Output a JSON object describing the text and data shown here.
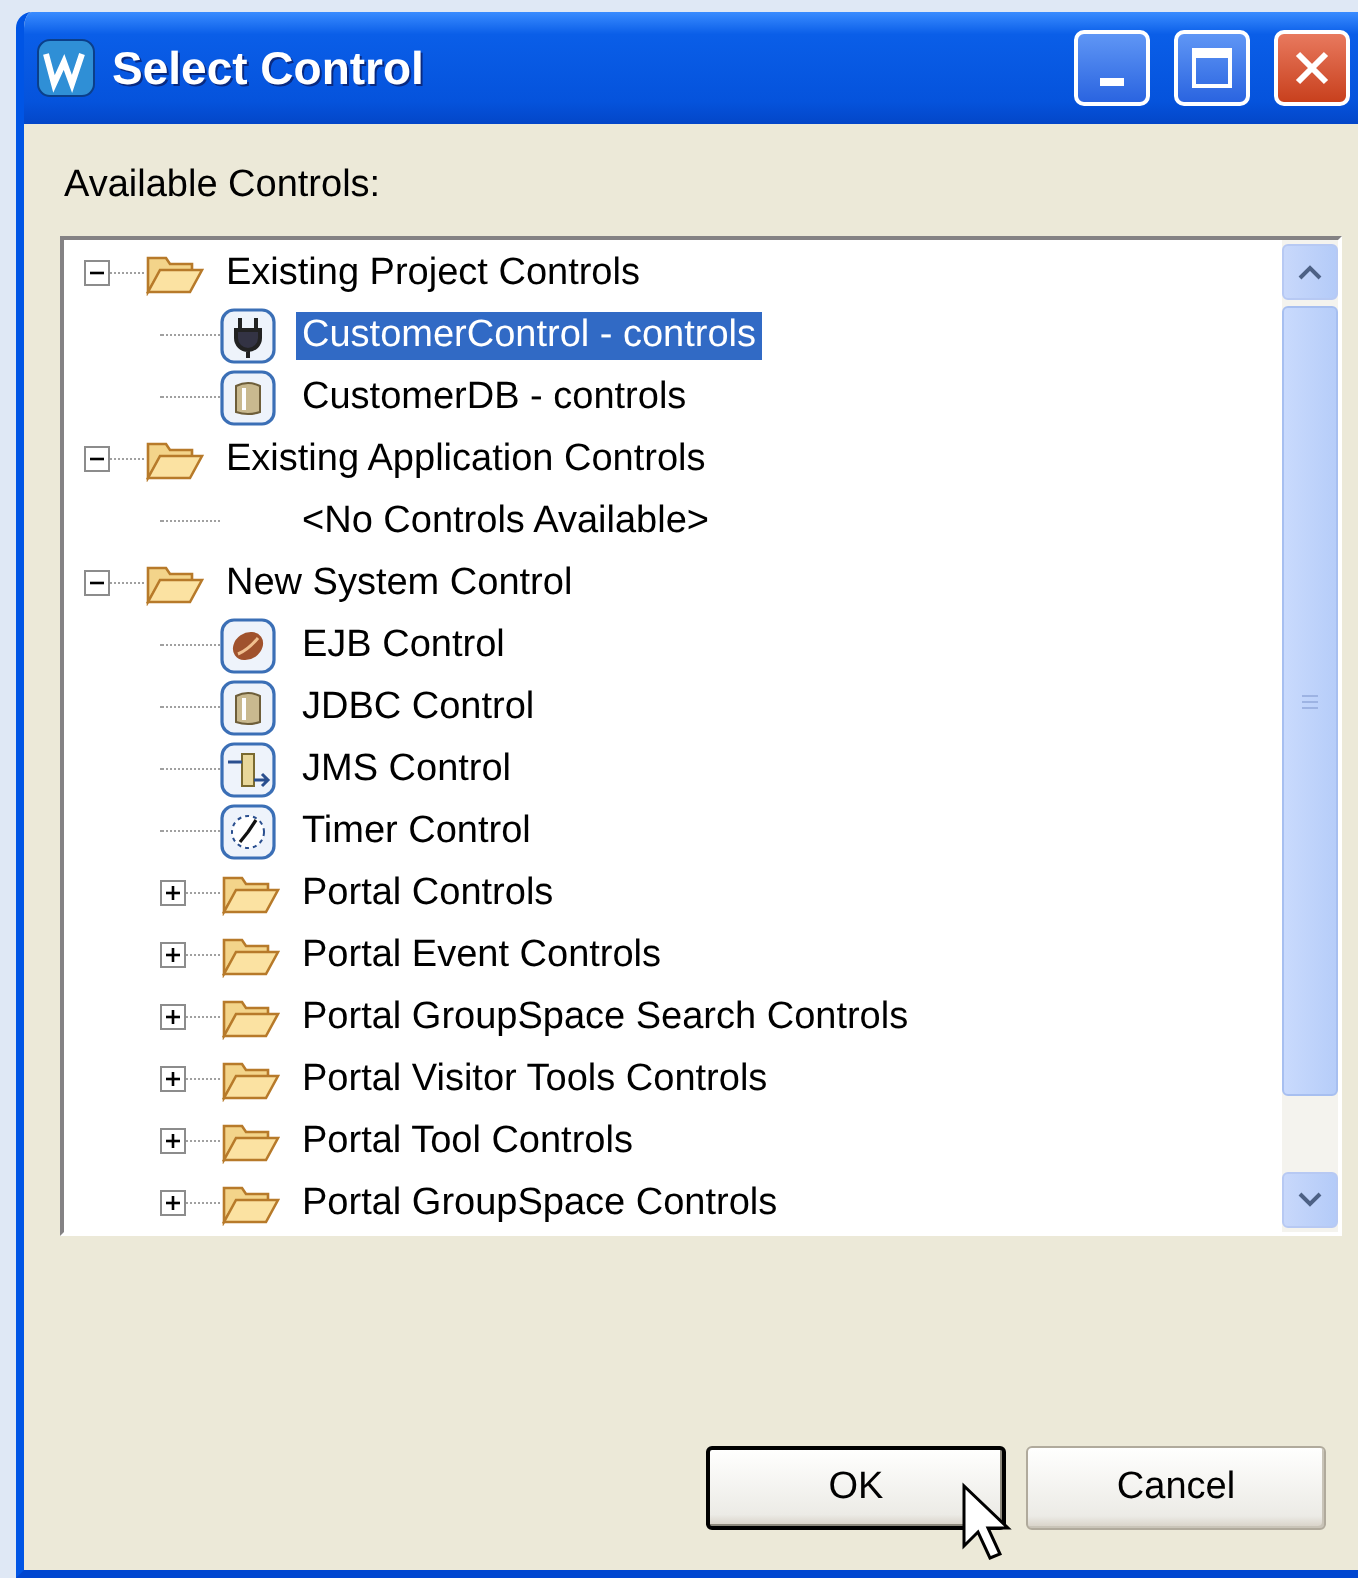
{
  "window": {
    "title": "Select Control"
  },
  "label": "Available Controls:",
  "tree": [
    {
      "label": "Existing Project Controls",
      "kind": "folder",
      "expanded": true,
      "selected": false,
      "children": [
        {
          "label": "CustomerControl - controls",
          "kind": "plug",
          "selected": true
        },
        {
          "label": "CustomerDB - controls",
          "kind": "database",
          "selected": false
        }
      ]
    },
    {
      "label": "Existing Application Controls",
      "kind": "folder",
      "expanded": true,
      "selected": false,
      "children": [
        {
          "label": "<No Controls Available>",
          "kind": "empty",
          "selected": false
        }
      ]
    },
    {
      "label": "New System Control",
      "kind": "folder",
      "expanded": true,
      "selected": false,
      "children": [
        {
          "label": "EJB Control",
          "kind": "bean",
          "selected": false
        },
        {
          "label": "JDBC Control",
          "kind": "database",
          "selected": false
        },
        {
          "label": "JMS Control",
          "kind": "queue",
          "selected": false
        },
        {
          "label": "Timer Control",
          "kind": "clock",
          "selected": false
        },
        {
          "label": "Portal Controls",
          "kind": "folder",
          "expanded": false,
          "selected": false
        },
        {
          "label": "Portal Event Controls",
          "kind": "folder",
          "expanded": false,
          "selected": false
        },
        {
          "label": "Portal GroupSpace Search Controls",
          "kind": "folder",
          "expanded": false,
          "selected": false
        },
        {
          "label": "Portal Visitor Tools Controls",
          "kind": "folder",
          "expanded": false,
          "selected": false
        },
        {
          "label": "Portal Tool Controls",
          "kind": "folder",
          "expanded": false,
          "selected": false
        },
        {
          "label": "Portal GroupSpace Controls",
          "kind": "folder",
          "expanded": false,
          "selected": false
        }
      ]
    }
  ],
  "buttons": [
    {
      "label": "OK",
      "default": true
    },
    {
      "label": "Cancel",
      "default": false
    }
  ]
}
